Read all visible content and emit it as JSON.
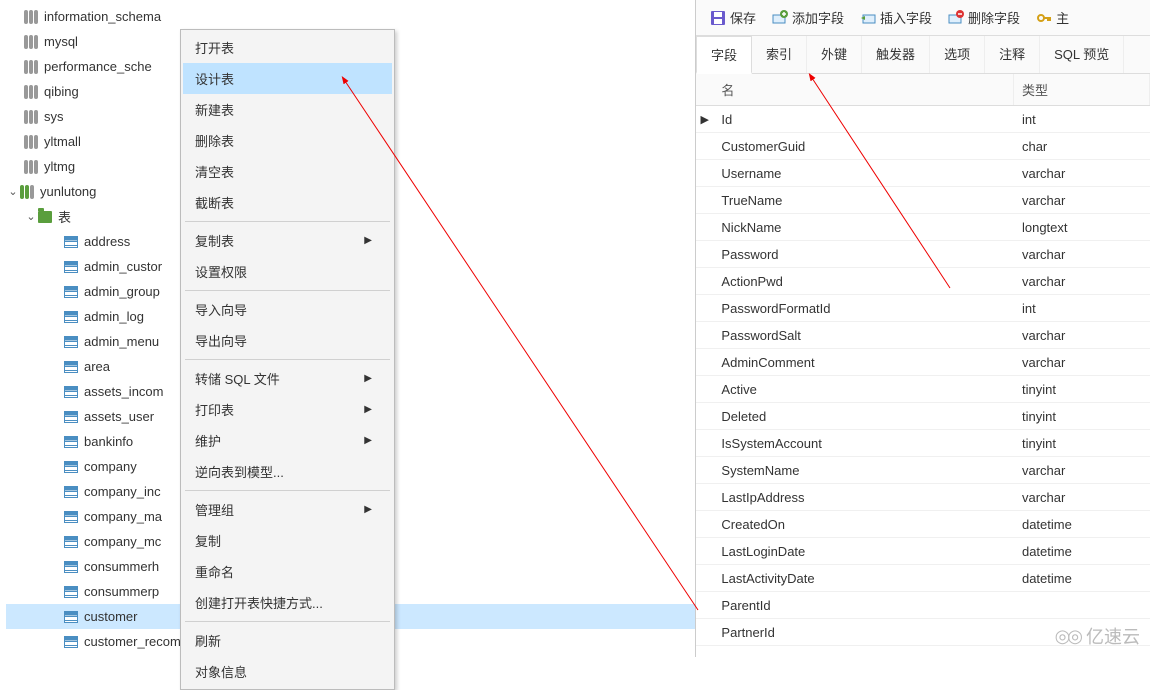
{
  "tree": {
    "databases": [
      {
        "name": "information_schema"
      },
      {
        "name": "mysql"
      },
      {
        "name": "performance_sche"
      },
      {
        "name": "qibing"
      },
      {
        "name": "sys"
      },
      {
        "name": "yltmall"
      },
      {
        "name": "yltmg"
      }
    ],
    "active_db": "yunlutong",
    "tables_label": "表",
    "tables": [
      "address",
      "admin_custor",
      "admin_group",
      "admin_log",
      "admin_menu",
      "area",
      "assets_incom",
      "assets_user",
      "bankinfo",
      "company",
      "company_inc",
      "company_ma",
      "company_mc",
      "consummerh",
      "consummerp",
      "customer",
      "customer_recommends"
    ],
    "selected_table": "customer"
  },
  "context_menu": {
    "items": [
      {
        "label": "打开表",
        "submenu": false
      },
      {
        "label": "设计表",
        "submenu": false,
        "highlight": true
      },
      {
        "label": "新建表",
        "submenu": false
      },
      {
        "label": "删除表",
        "submenu": false
      },
      {
        "label": "清空表",
        "submenu": false
      },
      {
        "label": "截断表",
        "submenu": false
      },
      {
        "sep": true
      },
      {
        "label": "复制表",
        "submenu": true
      },
      {
        "label": "设置权限",
        "submenu": false
      },
      {
        "sep": true
      },
      {
        "label": "导入向导",
        "submenu": false
      },
      {
        "label": "导出向导",
        "submenu": false
      },
      {
        "sep": true
      },
      {
        "label": "转储 SQL 文件",
        "submenu": true
      },
      {
        "label": "打印表",
        "submenu": true
      },
      {
        "label": "维护",
        "submenu": true
      },
      {
        "label": "逆向表到模型...",
        "submenu": false
      },
      {
        "sep": true
      },
      {
        "label": "管理组",
        "submenu": true
      },
      {
        "label": "复制",
        "submenu": false
      },
      {
        "label": "重命名",
        "submenu": false
      },
      {
        "label": "创建打开表快捷方式...",
        "submenu": false
      },
      {
        "sep": true
      },
      {
        "label": "刷新",
        "submenu": false
      },
      {
        "label": "对象信息",
        "submenu": false
      }
    ]
  },
  "toolbar": {
    "save": "保存",
    "add_field": "添加字段",
    "insert_field": "插入字段",
    "delete_field": "删除字段",
    "primary_key": "主"
  },
  "tabs": [
    "字段",
    "索引",
    "外键",
    "触发器",
    "选项",
    "注释",
    "SQL 预览"
  ],
  "active_tab": "字段",
  "grid": {
    "headers": {
      "name": "名",
      "type": "类型"
    },
    "rows": [
      {
        "name": "Id",
        "type": "int",
        "marker": true
      },
      {
        "name": "CustomerGuid",
        "type": "char"
      },
      {
        "name": "Username",
        "type": "varchar"
      },
      {
        "name": "TrueName",
        "type": "varchar"
      },
      {
        "name": "NickName",
        "type": "longtext"
      },
      {
        "name": "Password",
        "type": "varchar"
      },
      {
        "name": "ActionPwd",
        "type": "varchar"
      },
      {
        "name": "PasswordFormatId",
        "type": "int"
      },
      {
        "name": "PasswordSalt",
        "type": "varchar"
      },
      {
        "name": "AdminComment",
        "type": "varchar"
      },
      {
        "name": "Active",
        "type": "tinyint"
      },
      {
        "name": "Deleted",
        "type": "tinyint"
      },
      {
        "name": "IsSystemAccount",
        "type": "tinyint"
      },
      {
        "name": "SystemName",
        "type": "varchar"
      },
      {
        "name": "LastIpAddress",
        "type": "varchar"
      },
      {
        "name": "CreatedOn",
        "type": "datetime"
      },
      {
        "name": "LastLoginDate",
        "type": "datetime"
      },
      {
        "name": "LastActivityDate",
        "type": "datetime"
      },
      {
        "name": "ParentId",
        "type": ""
      },
      {
        "name": "PartnerId",
        "type": ""
      }
    ]
  },
  "watermark": "亿速云"
}
